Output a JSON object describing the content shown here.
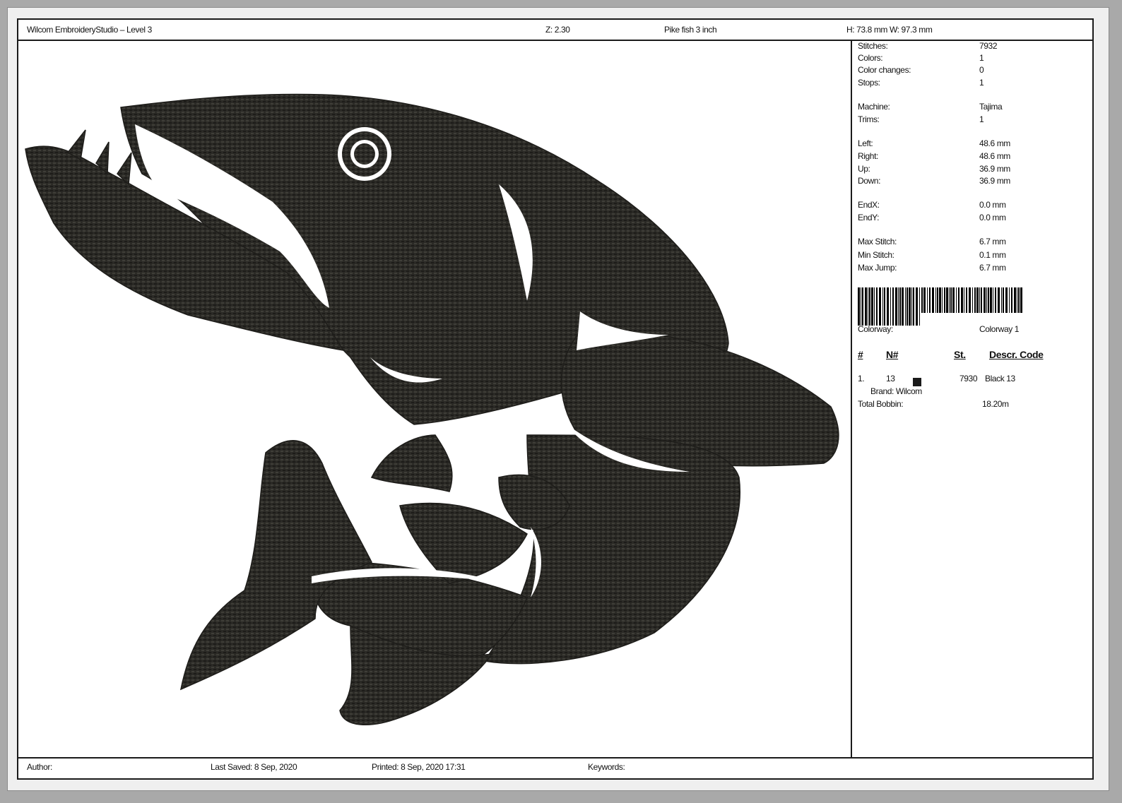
{
  "header": {
    "app_title": "Wilcom EmbroideryStudio – Level 3",
    "zoom": "Z: 2.30",
    "design_name": "Pike fish 3 inch",
    "dimensions": "H: 73.8 mm   W: 97.3 mm"
  },
  "stats": [
    {
      "label": "Stitches:",
      "value": "7932"
    },
    {
      "label": "Colors:",
      "value": "1"
    },
    {
      "label": "Color changes:",
      "value": "0"
    },
    {
      "label": "Stops:",
      "value": "1"
    },
    {
      "label": "Machine:",
      "value": "Tajima"
    },
    {
      "label": "Trims:",
      "value": "1"
    },
    {
      "label": "Left:",
      "value": "48.6 mm"
    },
    {
      "label": "Right:",
      "value": "48.6 mm"
    },
    {
      "label": "Up:",
      "value": "36.9 mm"
    },
    {
      "label": "Down:",
      "value": "36.9 mm"
    },
    {
      "label": "EndX:",
      "value": "0.0 mm"
    },
    {
      "label": "EndY:",
      "value": "0.0 mm"
    },
    {
      "label": "Max Stitch:",
      "value": "6.7 mm"
    },
    {
      "label": "Min Stitch:",
      "value": "0.1 mm"
    },
    {
      "label": "Max Jump:",
      "value": "6.7 mm"
    }
  ],
  "colorway": {
    "label": "Colorway:",
    "value": "Colorway 1"
  },
  "table": {
    "headers": [
      "#",
      "N#",
      "St.",
      "Descr. Code"
    ],
    "rows": [
      {
        "index": "1.",
        "number": "13",
        "stitches": "7930",
        "descr": "Black 13",
        "brand": "Brand: Wilcom",
        "color": "#1a1a1a"
      }
    ]
  },
  "total_bobbin": {
    "label": "Total Bobbin:",
    "value": "18.20m"
  },
  "footer": {
    "author": "Author:",
    "last_saved": "Last Saved:  8 Sep, 2020",
    "printed": "Printed:  8 Sep, 2020 17:31",
    "keywords": "Keywords:"
  },
  "colors": {
    "thread": "#2b2a26",
    "page": "#ffffff",
    "background": "#a9a9a9"
  }
}
